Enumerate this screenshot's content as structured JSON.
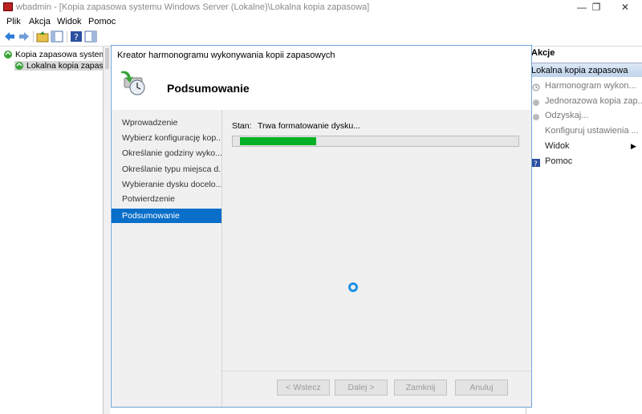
{
  "window": {
    "title": "wbadmin - [Kopia zapasowa systemu Windows Server (Lokalne)\\Lokalna kopia zapasowa]",
    "minimize": "—",
    "restore": "❐",
    "close": "✕"
  },
  "menu": [
    "Plik",
    "Akcja",
    "Widok",
    "Pomoc"
  ],
  "tree": {
    "root": "Kopia zapasowa systemu W",
    "child": "Lokalna kopia zapasowa"
  },
  "actions": {
    "header": "Akcje",
    "section": "Lokalna kopia zapasowa",
    "items": [
      {
        "label": "Harmonogram wykon...",
        "icon": "schedule-icon",
        "disabled": true
      },
      {
        "label": "Jednorazowa kopia zap...",
        "icon": "backup-once-icon",
        "disabled": true
      },
      {
        "label": "Odzyskaj...",
        "icon": "recover-icon",
        "disabled": true
      },
      {
        "label": "Konfiguruj ustawienia ...",
        "icon": "",
        "disabled": true
      },
      {
        "label": "Widok",
        "icon": "",
        "disabled": false,
        "submenu": "▶"
      },
      {
        "label": "Pomoc",
        "icon": "help-icon",
        "disabled": false
      }
    ]
  },
  "dialog": {
    "title": "Kreator harmonogramu wykonywania kopii zapasowych",
    "heading": "Podsumowanie",
    "steps": [
      "Wprowadzenie",
      "Wybierz konfigurację kop...",
      "Określanie godziny wyko...",
      "Określanie typu miejsca d...",
      "Wybieranie dysku docelo...",
      "Potwierdzenie",
      "Podsumowanie"
    ],
    "active_step": 6,
    "status_label": "Stan:",
    "status_text": "Trwa formatowanie dysku...",
    "progress_fraction": 0.28,
    "buttons": {
      "back": "< Wstecz",
      "next": "Dalej >",
      "close": "Zamknij",
      "cancel": "Anuluj"
    }
  },
  "colors": {
    "accent": "#0a6fc9",
    "progress": "#06b025",
    "dialog_border": "#6fa4d8"
  }
}
